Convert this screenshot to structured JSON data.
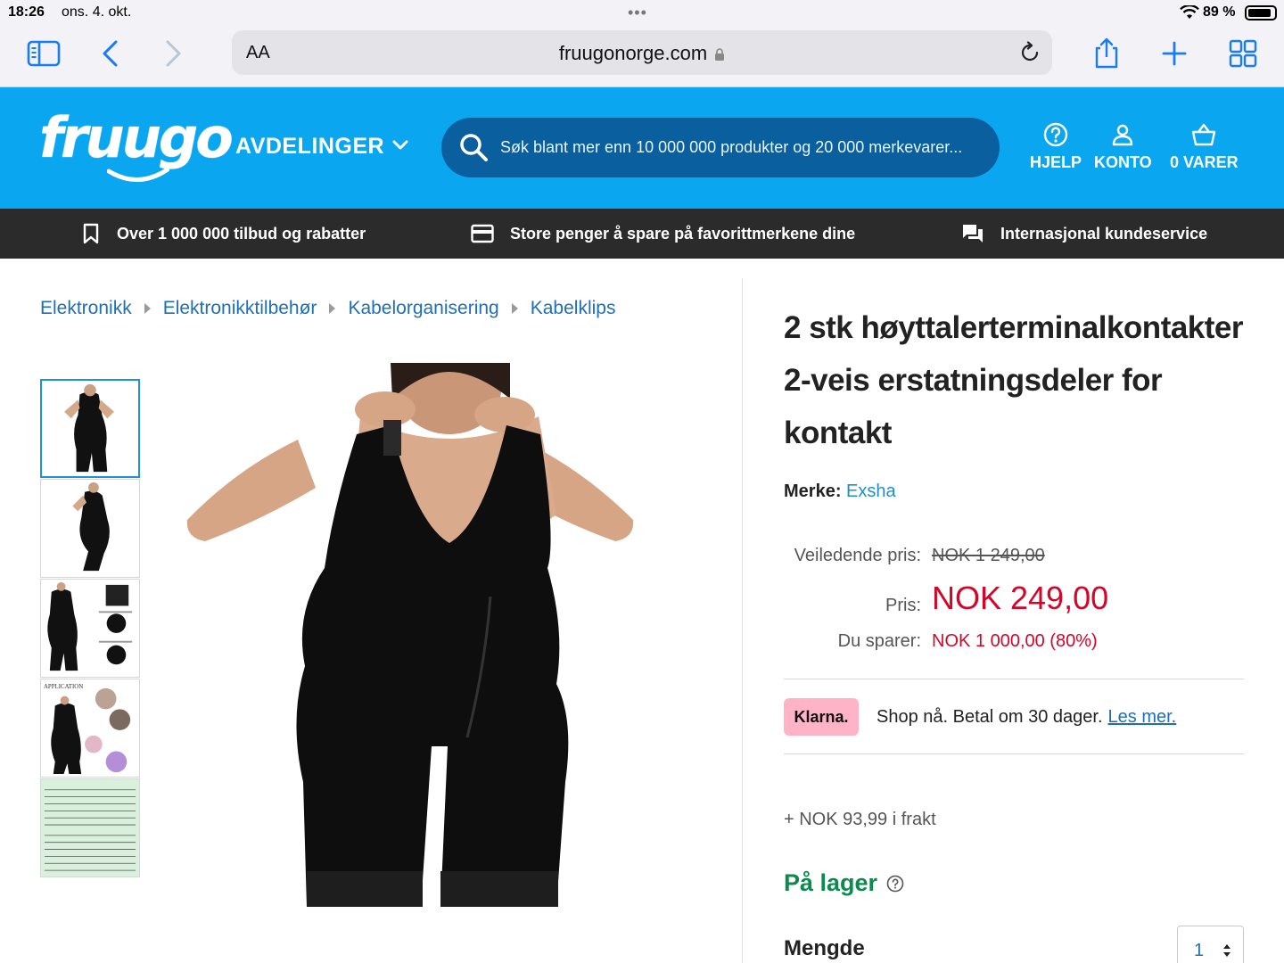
{
  "status": {
    "time": "18:26",
    "date": "ons. 4. okt.",
    "battery": "89 %",
    "battery_level": 0.89
  },
  "browser": {
    "aa_label": "AA",
    "url": "fruugonorge.com"
  },
  "header": {
    "logo": "fruugo",
    "departments_label": "AVDELINGER",
    "search_placeholder": "Søk blant mer enn 10 000 000 produkter og 20 000 merkevarer...",
    "help_label": "HJELP",
    "account_label": "KONTO",
    "cart_label": "0 VARER"
  },
  "promo": {
    "item1": "Over 1 000 000 tilbud og rabatter",
    "item2": "Store penger å spare på favorittmerkene dine",
    "item3": "Internasjonal kundeservice"
  },
  "breadcrumb": [
    "Elektronikk",
    "Elektronikktilbehør",
    "Kabelorganisering",
    "Kabelklips"
  ],
  "product": {
    "title_line1": "2 stk høyttalerterminalkontakter",
    "title_line2": "2-veis erstatningsdeler for",
    "title_line3": "kontakt",
    "brand_label": "Merke:",
    "brand_value": "Exsha",
    "rrp_label": "Veiledende pris:",
    "rrp_value": "NOK 1 249,00",
    "price_label": "Pris:",
    "price_value": "NOK 249,00",
    "save_label": "Du sparer:",
    "save_value": "NOK 1 000,00 (80%)",
    "klarna_badge": "Klarna.",
    "klarna_text": "Shop nå. Betal om 30 dager.",
    "klarna_link": "Les mer.",
    "shipping": "+ NOK 93,99 i frakt",
    "stock": "På lager",
    "quantity_label": "Mengde",
    "quantity_value": "1"
  },
  "thumbs": {
    "thumb4_caption": "APPLICATION"
  },
  "colors": {
    "brand_blue": "#0aa6f0",
    "search_bg": "#0a5f9e",
    "promo_bg": "#2b2b2b",
    "price_red": "#d3062a",
    "stock_green": "#0c8a4f",
    "klarna_pink": "#ffb3c7"
  }
}
